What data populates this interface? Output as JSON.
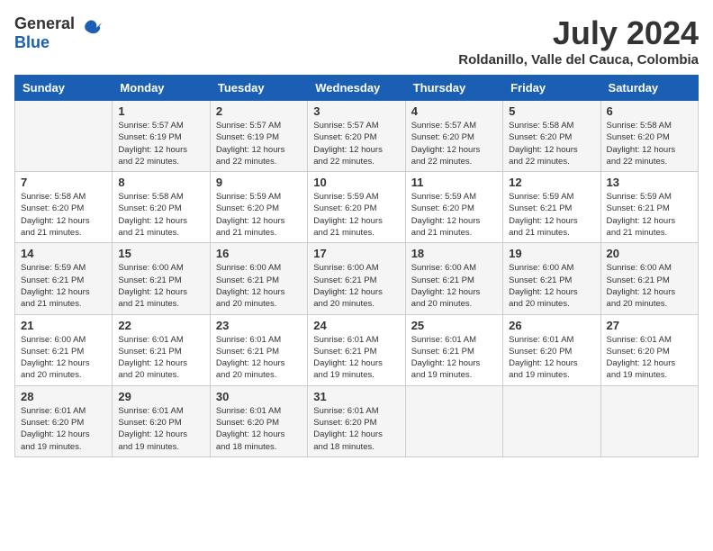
{
  "header": {
    "logo_general": "General",
    "logo_blue": "Blue",
    "month_year": "July 2024",
    "location": "Roldanillo, Valle del Cauca, Colombia"
  },
  "days_of_week": [
    "Sunday",
    "Monday",
    "Tuesday",
    "Wednesday",
    "Thursday",
    "Friday",
    "Saturday"
  ],
  "weeks": [
    [
      {
        "day": "",
        "info": ""
      },
      {
        "day": "1",
        "info": "Sunrise: 5:57 AM\nSunset: 6:19 PM\nDaylight: 12 hours\nand 22 minutes."
      },
      {
        "day": "2",
        "info": "Sunrise: 5:57 AM\nSunset: 6:19 PM\nDaylight: 12 hours\nand 22 minutes."
      },
      {
        "day": "3",
        "info": "Sunrise: 5:57 AM\nSunset: 6:20 PM\nDaylight: 12 hours\nand 22 minutes."
      },
      {
        "day": "4",
        "info": "Sunrise: 5:57 AM\nSunset: 6:20 PM\nDaylight: 12 hours\nand 22 minutes."
      },
      {
        "day": "5",
        "info": "Sunrise: 5:58 AM\nSunset: 6:20 PM\nDaylight: 12 hours\nand 22 minutes."
      },
      {
        "day": "6",
        "info": "Sunrise: 5:58 AM\nSunset: 6:20 PM\nDaylight: 12 hours\nand 22 minutes."
      }
    ],
    [
      {
        "day": "7",
        "info": "Sunrise: 5:58 AM\nSunset: 6:20 PM\nDaylight: 12 hours\nand 21 minutes."
      },
      {
        "day": "8",
        "info": "Sunrise: 5:58 AM\nSunset: 6:20 PM\nDaylight: 12 hours\nand 21 minutes."
      },
      {
        "day": "9",
        "info": "Sunrise: 5:59 AM\nSunset: 6:20 PM\nDaylight: 12 hours\nand 21 minutes."
      },
      {
        "day": "10",
        "info": "Sunrise: 5:59 AM\nSunset: 6:20 PM\nDaylight: 12 hours\nand 21 minutes."
      },
      {
        "day": "11",
        "info": "Sunrise: 5:59 AM\nSunset: 6:20 PM\nDaylight: 12 hours\nand 21 minutes."
      },
      {
        "day": "12",
        "info": "Sunrise: 5:59 AM\nSunset: 6:21 PM\nDaylight: 12 hours\nand 21 minutes."
      },
      {
        "day": "13",
        "info": "Sunrise: 5:59 AM\nSunset: 6:21 PM\nDaylight: 12 hours\nand 21 minutes."
      }
    ],
    [
      {
        "day": "14",
        "info": "Sunrise: 5:59 AM\nSunset: 6:21 PM\nDaylight: 12 hours\nand 21 minutes."
      },
      {
        "day": "15",
        "info": "Sunrise: 6:00 AM\nSunset: 6:21 PM\nDaylight: 12 hours\nand 21 minutes."
      },
      {
        "day": "16",
        "info": "Sunrise: 6:00 AM\nSunset: 6:21 PM\nDaylight: 12 hours\nand 20 minutes."
      },
      {
        "day": "17",
        "info": "Sunrise: 6:00 AM\nSunset: 6:21 PM\nDaylight: 12 hours\nand 20 minutes."
      },
      {
        "day": "18",
        "info": "Sunrise: 6:00 AM\nSunset: 6:21 PM\nDaylight: 12 hours\nand 20 minutes."
      },
      {
        "day": "19",
        "info": "Sunrise: 6:00 AM\nSunset: 6:21 PM\nDaylight: 12 hours\nand 20 minutes."
      },
      {
        "day": "20",
        "info": "Sunrise: 6:00 AM\nSunset: 6:21 PM\nDaylight: 12 hours\nand 20 minutes."
      }
    ],
    [
      {
        "day": "21",
        "info": "Sunrise: 6:00 AM\nSunset: 6:21 PM\nDaylight: 12 hours\nand 20 minutes."
      },
      {
        "day": "22",
        "info": "Sunrise: 6:01 AM\nSunset: 6:21 PM\nDaylight: 12 hours\nand 20 minutes."
      },
      {
        "day": "23",
        "info": "Sunrise: 6:01 AM\nSunset: 6:21 PM\nDaylight: 12 hours\nand 20 minutes."
      },
      {
        "day": "24",
        "info": "Sunrise: 6:01 AM\nSunset: 6:21 PM\nDaylight: 12 hours\nand 19 minutes."
      },
      {
        "day": "25",
        "info": "Sunrise: 6:01 AM\nSunset: 6:21 PM\nDaylight: 12 hours\nand 19 minutes."
      },
      {
        "day": "26",
        "info": "Sunrise: 6:01 AM\nSunset: 6:20 PM\nDaylight: 12 hours\nand 19 minutes."
      },
      {
        "day": "27",
        "info": "Sunrise: 6:01 AM\nSunset: 6:20 PM\nDaylight: 12 hours\nand 19 minutes."
      }
    ],
    [
      {
        "day": "28",
        "info": "Sunrise: 6:01 AM\nSunset: 6:20 PM\nDaylight: 12 hours\nand 19 minutes."
      },
      {
        "day": "29",
        "info": "Sunrise: 6:01 AM\nSunset: 6:20 PM\nDaylight: 12 hours\nand 19 minutes."
      },
      {
        "day": "30",
        "info": "Sunrise: 6:01 AM\nSunset: 6:20 PM\nDaylight: 12 hours\nand 18 minutes."
      },
      {
        "day": "31",
        "info": "Sunrise: 6:01 AM\nSunset: 6:20 PM\nDaylight: 12 hours\nand 18 minutes."
      },
      {
        "day": "",
        "info": ""
      },
      {
        "day": "",
        "info": ""
      },
      {
        "day": "",
        "info": ""
      }
    ]
  ]
}
